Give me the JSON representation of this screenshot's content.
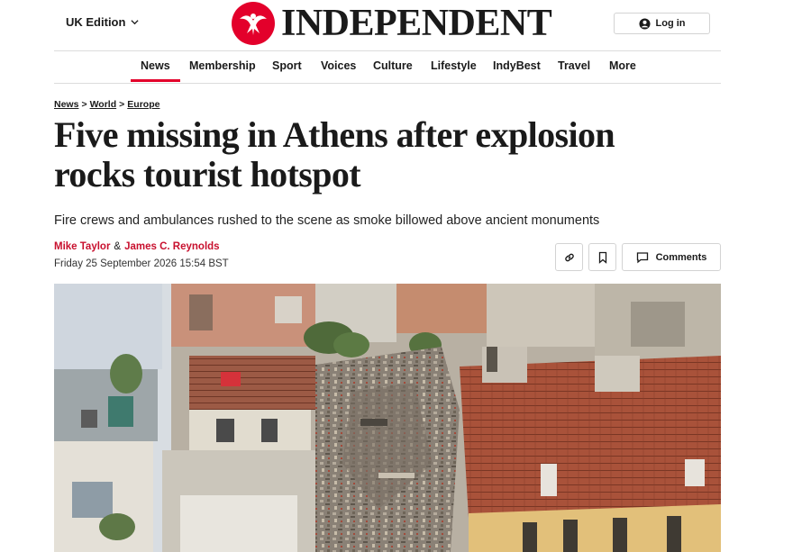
{
  "header": {
    "edition_label": "UK Edition",
    "logo_text": "INDEPENDENT",
    "login_label": "Log in"
  },
  "nav": {
    "items": [
      {
        "label": "News",
        "active": true
      },
      {
        "label": "Membership",
        "active": false
      },
      {
        "label": "Sport",
        "active": false
      },
      {
        "label": "Voices",
        "active": false
      },
      {
        "label": "Culture",
        "active": false
      },
      {
        "label": "Lifestyle",
        "active": false
      },
      {
        "label": "IndyBest",
        "active": false
      },
      {
        "label": "Travel",
        "active": false
      },
      {
        "label": "More",
        "active": false
      }
    ]
  },
  "breadcrumb": {
    "items": [
      "News",
      "World",
      "Europe"
    ],
    "separator": ">"
  },
  "article": {
    "headline_line1": "Five missing in Athens after explosion",
    "headline_line2": "rocks tourist hotspot",
    "standfirst": "Fire crews and ambulances rushed to the scene as smoke billowed above ancient monuments",
    "authors": [
      "Mike Taylor",
      "James C. Reynolds"
    ],
    "author_joiner": "&",
    "date": "Friday 25 September 2026 15:54 BST"
  },
  "actions": {
    "comments_label": "Comments"
  },
  "colors": {
    "brand_red": "#e3002b",
    "author_red": "#c8102e"
  },
  "icons": [
    "chevron-down-icon",
    "eagle-logo-icon",
    "user-icon",
    "link-icon",
    "bookmark-icon",
    "comment-icon"
  ]
}
